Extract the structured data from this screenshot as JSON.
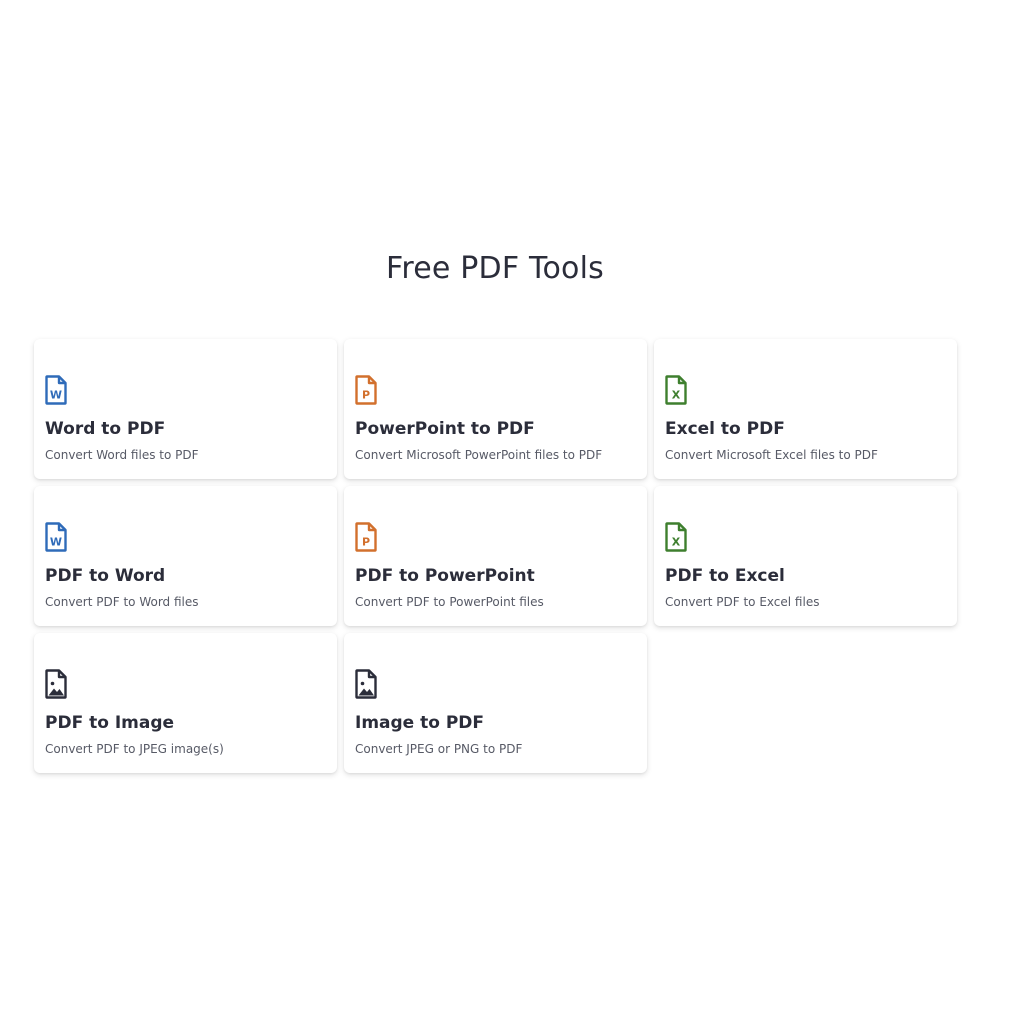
{
  "page": {
    "title": "Free PDF Tools"
  },
  "colors": {
    "word": "#2f6bb9",
    "powerpoint": "#d2702d",
    "excel": "#3e7f2e",
    "image": "#2b2d3a"
  },
  "tools": [
    {
      "title": "Word to PDF",
      "description": "Convert Word files to PDF",
      "icon": "word-file-icon",
      "icon_letter": "W"
    },
    {
      "title": "PowerPoint to PDF",
      "description": "Convert Microsoft PowerPoint files to PDF",
      "icon": "powerpoint-file-icon",
      "icon_letter": "P"
    },
    {
      "title": "Excel to PDF",
      "description": "Convert Microsoft Excel files to PDF",
      "icon": "excel-file-icon",
      "icon_letter": "X"
    },
    {
      "title": "PDF to Word",
      "description": "Convert PDF to Word files",
      "icon": "word-file-icon",
      "icon_letter": "W"
    },
    {
      "title": "PDF to PowerPoint",
      "description": "Convert PDF to PowerPoint files",
      "icon": "powerpoint-file-icon",
      "icon_letter": "P"
    },
    {
      "title": "PDF to Excel",
      "description": "Convert PDF to Excel files",
      "icon": "excel-file-icon",
      "icon_letter": "X"
    },
    {
      "title": "PDF to Image",
      "description": "Convert PDF to JPEG image(s)",
      "icon": "image-file-icon",
      "icon_letter": ""
    },
    {
      "title": "Image to PDF",
      "description": "Convert JPEG or PNG to PDF",
      "icon": "image-file-icon",
      "icon_letter": ""
    }
  ]
}
